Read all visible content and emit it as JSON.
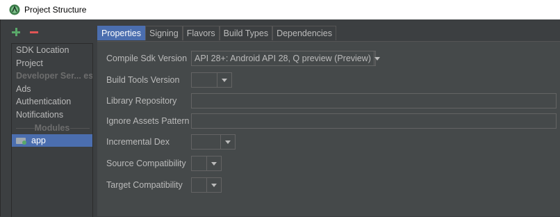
{
  "window": {
    "title": "Project Structure"
  },
  "toolbar": {
    "add_icon": "plus-icon",
    "remove_icon": "minus-icon"
  },
  "sidebar": {
    "items": [
      {
        "label": "SDK Location"
      },
      {
        "label": "Project"
      },
      {
        "label": "Developer Ser... es"
      },
      {
        "label": "Ads"
      },
      {
        "label": "Authentication"
      },
      {
        "label": "Notifications"
      }
    ],
    "section_label": "Modules",
    "module": {
      "label": "app"
    }
  },
  "tabs": [
    {
      "label": "Properties"
    },
    {
      "label": "Signing"
    },
    {
      "label": "Flavors"
    },
    {
      "label": "Build Types"
    },
    {
      "label": "Dependencies"
    }
  ],
  "form": {
    "compile_sdk": {
      "label": "Compile Sdk Version",
      "value": "API 28+: Android API 28, Q preview (Preview)"
    },
    "build_tools": {
      "label": "Build Tools Version",
      "value": ""
    },
    "library_repo": {
      "label": "Library Repository",
      "value": ""
    },
    "ignore_assets": {
      "label": "Ignore Assets Pattern",
      "value": ""
    },
    "incremental_dex": {
      "label": "Incremental Dex",
      "value": ""
    },
    "source_compat": {
      "label": "Source Compatibility",
      "value": ""
    },
    "target_compat": {
      "label": "Target Compatibility",
      "value": ""
    }
  },
  "colors": {
    "accent": "#4b6eaf",
    "background": "#3c3f41",
    "panel": "#45494a"
  }
}
